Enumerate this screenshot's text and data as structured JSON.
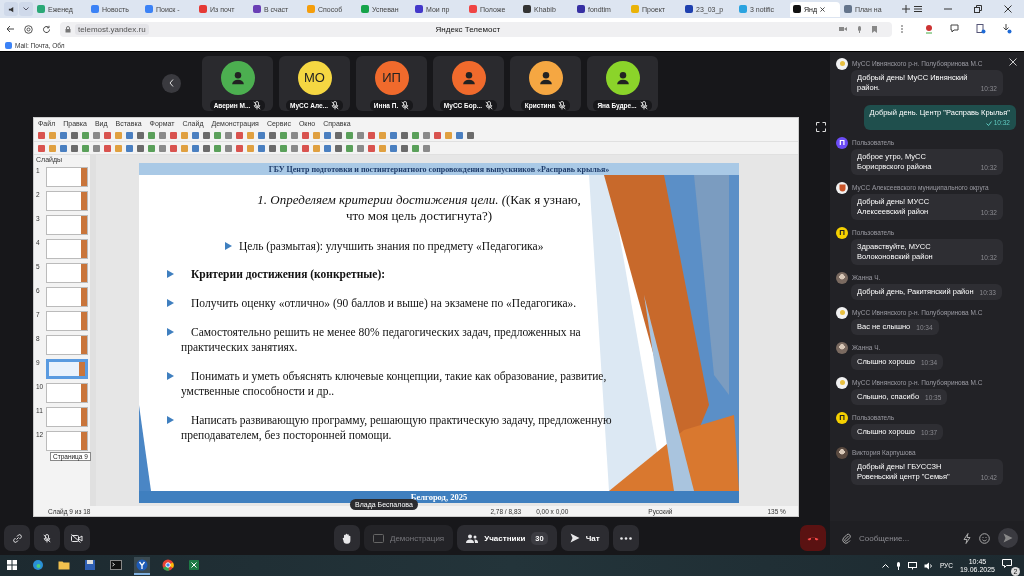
{
  "browser": {
    "tabs": [
      {
        "label": "Еженед",
        "color": "#2aa876",
        "selected": false
      },
      {
        "label": "Новость",
        "color": "#3b82f6",
        "selected": false
      },
      {
        "label": "Поиск - ",
        "color": "#3b82f6",
        "selected": false
      },
      {
        "label": "Из почт",
        "color": "#e53935",
        "selected": false
      },
      {
        "label": "В счаст",
        "color": "#6a3fb5",
        "selected": false
      },
      {
        "label": "Способ",
        "color": "#f59e0b",
        "selected": false
      },
      {
        "label": "Успеван",
        "color": "#16a34a",
        "selected": false
      },
      {
        "label": "Мои пр",
        "color": "#4338ca",
        "selected": false
      },
      {
        "label": "Положе",
        "color": "#ef4444",
        "selected": false
      },
      {
        "label": "Khabib",
        "color": "#333333",
        "selected": false
      },
      {
        "label": "fondtim",
        "color": "#3730a3",
        "selected": false
      },
      {
        "label": "Проект",
        "color": "#eab308",
        "selected": false
      },
      {
        "label": "23_03_р",
        "color": "#1e40af",
        "selected": false
      },
      {
        "label": "3 notific",
        "color": "#2aa3e0",
        "selected": false
      },
      {
        "label": "Янд",
        "color": "#111111",
        "selected": true
      },
      {
        "label": "План на",
        "color": "#64748b",
        "selected": false
      }
    ],
    "url": "telemost.yandex.ru",
    "page_title": "Яндекс Телемост",
    "bookmarks": [
      {
        "label": "Mail: Почта, Обл",
        "color": "#3b82f6"
      }
    ]
  },
  "participants": [
    {
      "name": "Аверин М...",
      "color": "#4caf50",
      "muted": true
    },
    {
      "name": "МуСС Але...",
      "initials": "МО",
      "color": "#f5d742",
      "muted": true
    },
    {
      "name": "Инна П.",
      "initials": "ИП",
      "color": "#f06a2c",
      "muted": true
    },
    {
      "name": "МуСС Бор...",
      "color": "#f06a2c",
      "muted": true
    },
    {
      "name": "Кристина",
      "color": "#f5a742",
      "muted": true
    },
    {
      "name": "Яна Будре...",
      "color": "#8bd42a",
      "muted": true
    }
  ],
  "presentation": {
    "menu": [
      "Файл",
      "Правка",
      "Вид",
      "Вставка",
      "Формат",
      "Слайд",
      "Демонстрация",
      "Сервис",
      "Окно",
      "Справка"
    ],
    "slides_label": "Слайды",
    "thumbnails": [
      {
        "number": "1",
        "selected": false
      },
      {
        "number": "2",
        "selected": false
      },
      {
        "number": "3",
        "selected": false
      },
      {
        "number": "4",
        "selected": false
      },
      {
        "number": "5",
        "selected": false
      },
      {
        "number": "6",
        "selected": false
      },
      {
        "number": "7",
        "selected": false
      },
      {
        "number": "8",
        "selected": false
      },
      {
        "number": "9",
        "selected": true
      },
      {
        "number": "10",
        "selected": false
      },
      {
        "number": "11",
        "selected": false
      },
      {
        "number": "12",
        "selected": false
      }
    ],
    "tooltip": "Страница 9",
    "slide": {
      "header": "ГБУ Центр подготовки и постинтернатного сопровождения выпускников «Расправь крылья»",
      "title": "*1. Определяем критерии достижения цели. (*(Как я узнаю, что моя цель достигнута?)",
      "bullets": [
        {
          "kind": "goal",
          "text": "Цель (размытая): улучшить знания по предмету «Педагогика»"
        },
        {
          "kind": "heading",
          "text": "Критерии достижения (конкретные):"
        },
        {
          "kind": "item",
          "text": "Получить оценку «отлично» (90 баллов и выше) на экзамене по «Педагогика»."
        },
        {
          "kind": "item",
          "text": "Самостоятельно решить не менее 80% педагогических задач, предложенных на практических занятиях."
        },
        {
          "kind": "item",
          "text": "Понимать и уметь объяснять ключевые концепции, такие как образование, развитие, умственные способности и др.."
        },
        {
          "kind": "item",
          "text": "Написать развивающую программу, решающую практическую задачу, предложенную преподавателем, без посторонней помощи."
        }
      ],
      "footer": "Белгород, 2025"
    },
    "status": [
      "Слайд 9 из 18",
      "2,78 / 8,83",
      "0,00 x 0,00",
      "Русский",
      "135 %"
    ],
    "presenter": "Влада Беспалова"
  },
  "chat": {
    "messages": [
      {
        "kind": "emblem",
        "author": "МуСС Ивнянского р-н. Полубояринова М.С",
        "color": "#f2f2f2",
        "text": "Добрый день! МуСС Ивнянский район.",
        "time": "10:32"
      },
      {
        "kind": "own",
        "color": "#1f4f4d",
        "text": "Добрый день. Центр \"Расправь Крылья\"",
        "time": "10:32"
      },
      {
        "kind": "letter",
        "author": "Пользователь",
        "letter": "П",
        "color": "#6b4cf6",
        "text": "Доброе утро, МуСС Борисрвского района",
        "time": "10:32"
      },
      {
        "kind": "crest",
        "author": "МуСС Алексеевского муниципального округа",
        "color": "#f2f2f2",
        "text": "Добрый день! МУСС Алексеевский район",
        "time": "10:32"
      },
      {
        "kind": "letter",
        "author": "Пользователь",
        "letter": "П",
        "color": "#f5d000",
        "text": "Здравствуйте, МУСС Волоконовский район",
        "time": "10:32"
      },
      {
        "kind": "photo",
        "author": "Жанна Ч.",
        "color": "#7a6a60",
        "text": "Добрый день, Ракитянский район",
        "time": "10:33"
      },
      {
        "kind": "emblem",
        "author": "МуСС Ивнянского р-н. Полубояринова М.С",
        "color": "#f2f2f2",
        "text": "Вас не слышно",
        "time": "10:34"
      },
      {
        "kind": "photo",
        "author": "Жанна Ч.",
        "color": "#7a6a60",
        "text": "Слышно хорошо",
        "time": "10:34"
      },
      {
        "kind": "emblem",
        "author": "МуСС Ивнянского р-н. Полубояринова М.С",
        "color": "#f2f2f2",
        "text": "Слышно, спасибо",
        "time": "10:35"
      },
      {
        "kind": "letter",
        "author": "Пользователь",
        "letter": "П",
        "color": "#f5d000",
        "text": "Слышно хорошо",
        "time": "10:37"
      },
      {
        "kind": "photo",
        "author": "Виктория Карпушова",
        "color": "#5a4a40",
        "text": "Добрый день! ГБУССЗН Ровеньский центр \"Семья\"",
        "time": "10:42"
      }
    ],
    "placeholder": "Сообщение..."
  },
  "controls": {
    "demo": {
      "label": "Демонстрация",
      "disabled": true
    },
    "people": {
      "label": "Участники",
      "count": "30"
    },
    "chat": {
      "label": "Чат"
    }
  },
  "taskbar": {
    "apps": [
      {
        "kind": "edge",
        "selected": false
      },
      {
        "kind": "folder",
        "selected": false
      },
      {
        "kind": "save",
        "selected": false
      },
      {
        "kind": "terminal",
        "selected": false
      },
      {
        "kind": "yandex",
        "selected": true
      },
      {
        "kind": "chrome",
        "selected": false
      },
      {
        "kind": "excel",
        "selected": false
      }
    ],
    "lang": "РУС",
    "time": "10:45",
    "date": "19.06.2025",
    "notifications": "2"
  }
}
